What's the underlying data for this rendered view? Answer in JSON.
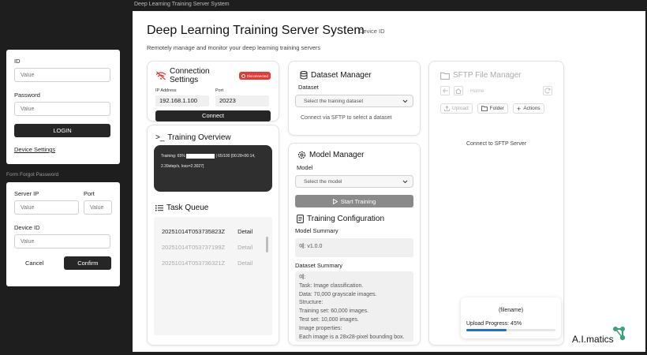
{
  "window": {
    "title": "Deep Learning Training Server System"
  },
  "login": {
    "id_label": "ID",
    "id_placeholder": "Value",
    "password_label": "Password",
    "password_placeholder": "Value",
    "login_button": "LOGIN",
    "device_settings_link": "Device Settings"
  },
  "forgot_form_label": "Form Forgot Password",
  "server_form": {
    "server_ip_label": "Server IP",
    "server_ip_placeholder": "Value",
    "port_label": "Port",
    "port_placeholder": "Value",
    "device_id_label": "Device ID",
    "device_id_placeholder": "Value",
    "cancel_button": "Cancel",
    "confirm_button": "Confirm"
  },
  "header": {
    "title": "Deep Learning Training Server System",
    "device_id": "Device ID",
    "subtitle": "Remotely manage and monitor your deep learning training servers"
  },
  "connection": {
    "title": "Connection Settings",
    "status_badge": "Disconnected",
    "ip_label": "IP Address",
    "ip_value": "192.168.1.100",
    "port_label": "Port",
    "port_value": "20223",
    "connect_button": "Connect"
  },
  "training_overview": {
    "title": "Training Overview",
    "log_prefix": "Training: 65%",
    "log_suffix": "| 65/100 [00:28<00:14,",
    "log_line2": "2.39step/s, loss=2.3027]",
    "progress": 0.65
  },
  "task_queue": {
    "title": "Task Queue",
    "tasks": [
      {
        "id": "20251014T053735823Z",
        "action": "Detail"
      },
      {
        "id": "20251014T053737199Z",
        "action": "Detail"
      },
      {
        "id": "20251014T053736321Z",
        "action": "Detail"
      }
    ]
  },
  "dataset_manager": {
    "title": "Dataset Manager",
    "dataset_label": "Dataset",
    "select_placeholder": "Select the training dataset",
    "hint": "Connect via SFTP to select a dataset"
  },
  "model_manager": {
    "title": "Model Manager",
    "model_label": "Model",
    "select_placeholder": "Select the model",
    "start_button": "Start Training"
  },
  "training_config": {
    "title": "Training Configuration",
    "model_summary_label": "Model Summary",
    "model_summary_value": "예: v1.0.0",
    "dataset_summary_label": "Dataset Summary",
    "dataset_summary_lines": [
      "예:",
      "Task: Image classification.",
      "Data: 70,000 grayscale images.",
      "Structure:",
      "Training set: 60,000 images.",
      "Test set: 10,000 images.",
      "Image properties:",
      "Each image is a 28x28-pixel bounding box."
    ]
  },
  "sftp": {
    "title": "SFTP File Manager",
    "home_label": "Home",
    "upload_button": "Upload",
    "folder_button": "Folder",
    "actions_button": "Actions",
    "empty_text": "Connect to SFTP Server"
  },
  "upload_toast": {
    "filename": "(filename)",
    "progress_label": "Upload Progress:",
    "progress_text": "45%",
    "progress": 0.45
  },
  "brand": {
    "logo_text": "A.I.matics"
  },
  "colors": {
    "danger": "#e53935",
    "dark": "#262626",
    "accent_blue": "#1e6fd9",
    "logo_green": "#3aa37a"
  },
  "icons": [
    "wifi-off-icon",
    "alert-icon",
    "terminal-icon",
    "list-icon",
    "database-icon",
    "gear-icon",
    "document-icon",
    "folder-icon",
    "arrow-left-icon",
    "home-icon",
    "refresh-icon",
    "upload-icon",
    "plus-icon",
    "chevron-down-icon",
    "play-icon"
  ]
}
